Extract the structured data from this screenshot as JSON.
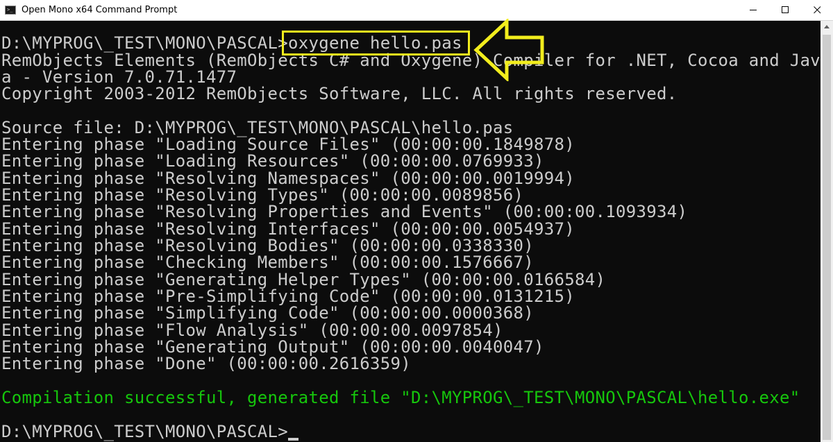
{
  "window": {
    "title": "Open Mono x64 Command Prompt",
    "icon": "command-prompt-icon",
    "controls": {
      "minimize": "minimize-icon",
      "maximize": "maximize-icon",
      "close": "close-icon"
    }
  },
  "terminal": {
    "lines": [
      "D:\\MYPROG\\_TEST\\MONO\\PASCAL>oxygene hello.pas",
      "RemObjects Elements (RemObjects C# and Oxygene) Compiler for .NET, Cocoa and Jav",
      "a - Version 7.0.71.1477",
      "Copyright 2003-2012 RemObjects Software, LLC. All rights reserved.",
      "",
      "Source file: D:\\MYPROG\\_TEST\\MONO\\PASCAL\\hello.pas",
      "Entering phase \"Loading Source Files\" (00:00:00.1849878)",
      "Entering phase \"Loading Resources\" (00:00:00.0769933)",
      "Entering phase \"Resolving Namespaces\" (00:00:00.0019994)",
      "Entering phase \"Resolving Types\" (00:00:00.0089856)",
      "Entering phase \"Resolving Properties and Events\" (00:00:00.1093934)",
      "Entering phase \"Resolving Interfaces\" (00:00:00.0054937)",
      "Entering phase \"Resolving Bodies\" (00:00:00.0338330)",
      "Entering phase \"Checking Members\" (00:00:00.1576667)",
      "Entering phase \"Generating Helper Types\" (00:00:00.0166584)",
      "Entering phase \"Pre-Simplifying Code\" (00:00:00.0131215)",
      "Entering phase \"Simplifying Code\" (00:00:00.0000368)",
      "Entering phase \"Flow Analysis\" (00:00:00.0097854)",
      "Entering phase \"Generating Output\" (00:00:00.0040047)",
      "Entering phase \"Done\" (00:00:00.2616359)",
      "",
      "Compilation successful, generated file \"D:\\MYPROG\\_TEST\\MONO\\PASCAL\\hello.exe\"",
      "",
      "D:\\MYPROG\\_TEST\\MONO\\PASCAL>"
    ],
    "success_line_index": 21
  },
  "annotation": {
    "highlight_color": "#f2ed1d",
    "arrow_icon": "arrow-left-icon"
  },
  "colors": {
    "terminal_background": "#0c0c0c",
    "terminal_text": "#cccccc",
    "success_text": "#16c60c"
  }
}
